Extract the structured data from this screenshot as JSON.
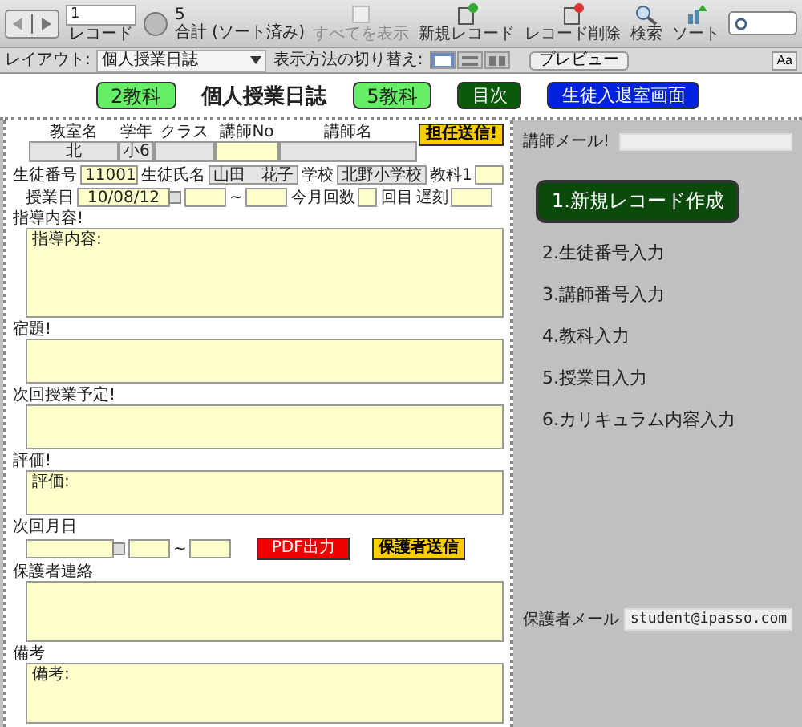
{
  "toolbar": {
    "record": {
      "value": "1",
      "label": "レコード"
    },
    "found": {
      "count": "5",
      "label": "合計 (ソート済み)"
    },
    "actions": [
      {
        "kind": "show_all",
        "label": "すべてを表示",
        "disabled": true
      },
      {
        "kind": "new",
        "label": "新規レコード",
        "disabled": false
      },
      {
        "kind": "delete",
        "label": "レコード削除",
        "disabled": false
      },
      {
        "kind": "find",
        "label": "検索",
        "disabled": false
      },
      {
        "kind": "sort",
        "label": "ソート",
        "disabled": false
      }
    ]
  },
  "layout_bar": {
    "label": "レイアウト:",
    "layout": "個人授業日誌",
    "view_label": "表示方法の切り替え:",
    "views": [
      {
        "kind": "form",
        "selected": true
      },
      {
        "kind": "list",
        "selected": false
      },
      {
        "kind": "table",
        "selected": false
      }
    ],
    "preview": "プレビュー",
    "font_button": "Aa"
  },
  "header": {
    "items": [
      {
        "kind": "button",
        "label": "2教科",
        "color": "#66ee66"
      },
      {
        "kind": "title",
        "label": "個人授業日誌"
      },
      {
        "kind": "button",
        "label": "5教科",
        "color": "#66ee66"
      },
      {
        "kind": "button",
        "label": "目次",
        "color": "#0a5a0a"
      },
      {
        "kind": "button",
        "label": "生徒入退室画面",
        "color": "#0022dd"
      }
    ]
  },
  "form": {
    "send_teacher": "担任送信!",
    "top_fields": [
      {
        "label": "教室名",
        "value": "北",
        "editable": false
      },
      {
        "label": "学年",
        "value": "小6",
        "editable": false
      },
      {
        "label": "クラス",
        "editable": false
      },
      {
        "label": "講師No",
        "editable": true
      },
      {
        "label": "講師名",
        "editable": false
      }
    ],
    "student_fields": [
      {
        "label": "生徒番号",
        "value": "11001",
        "editable": true
      },
      {
        "label": "生徒氏名",
        "value": "山田　花子",
        "editable": false
      },
      {
        "label": "学校",
        "value": "北野小学校",
        "editable": false
      },
      {
        "label": "教科1",
        "editable": true
      }
    ],
    "lesson_row": {
      "date_label": "授業日",
      "date": "10/08/12",
      "range_sep": "~",
      "count_label": "今月回数",
      "count_suffix": "回目",
      "late_label": "遅刻"
    },
    "notes_top": [
      {
        "label": "指導内容!",
        "value": "指導内容:"
      },
      {
        "label": "宿題!"
      },
      {
        "label": "次回授業予定!"
      },
      {
        "label": "評価!",
        "value": "評価:"
      }
    ],
    "next_row": {
      "label": "次回月日",
      "range_sep": "~",
      "pdf_button": "PDF出力",
      "send_parent": "保護者送信"
    },
    "notes_bottom": [
      {
        "label": "保護者連絡"
      },
      {
        "label": "備考",
        "value": "備考:"
      }
    ]
  },
  "side": {
    "teacher_mail_label": "講師メール!",
    "steps": [
      {
        "kind": "button",
        "label": "1.新規レコード作成"
      },
      {
        "kind": "text",
        "label": "2.生徒番号入力"
      },
      {
        "kind": "text",
        "label": "3.講師番号入力"
      },
      {
        "kind": "text",
        "label": "4.教科入力"
      },
      {
        "kind": "text",
        "label": "5.授業日入力"
      },
      {
        "kind": "text",
        "label": "6.カリキュラム内容入力"
      }
    ],
    "parent_mail": {
      "label": "保護者メール",
      "value": "student@ipasso.com"
    }
  }
}
